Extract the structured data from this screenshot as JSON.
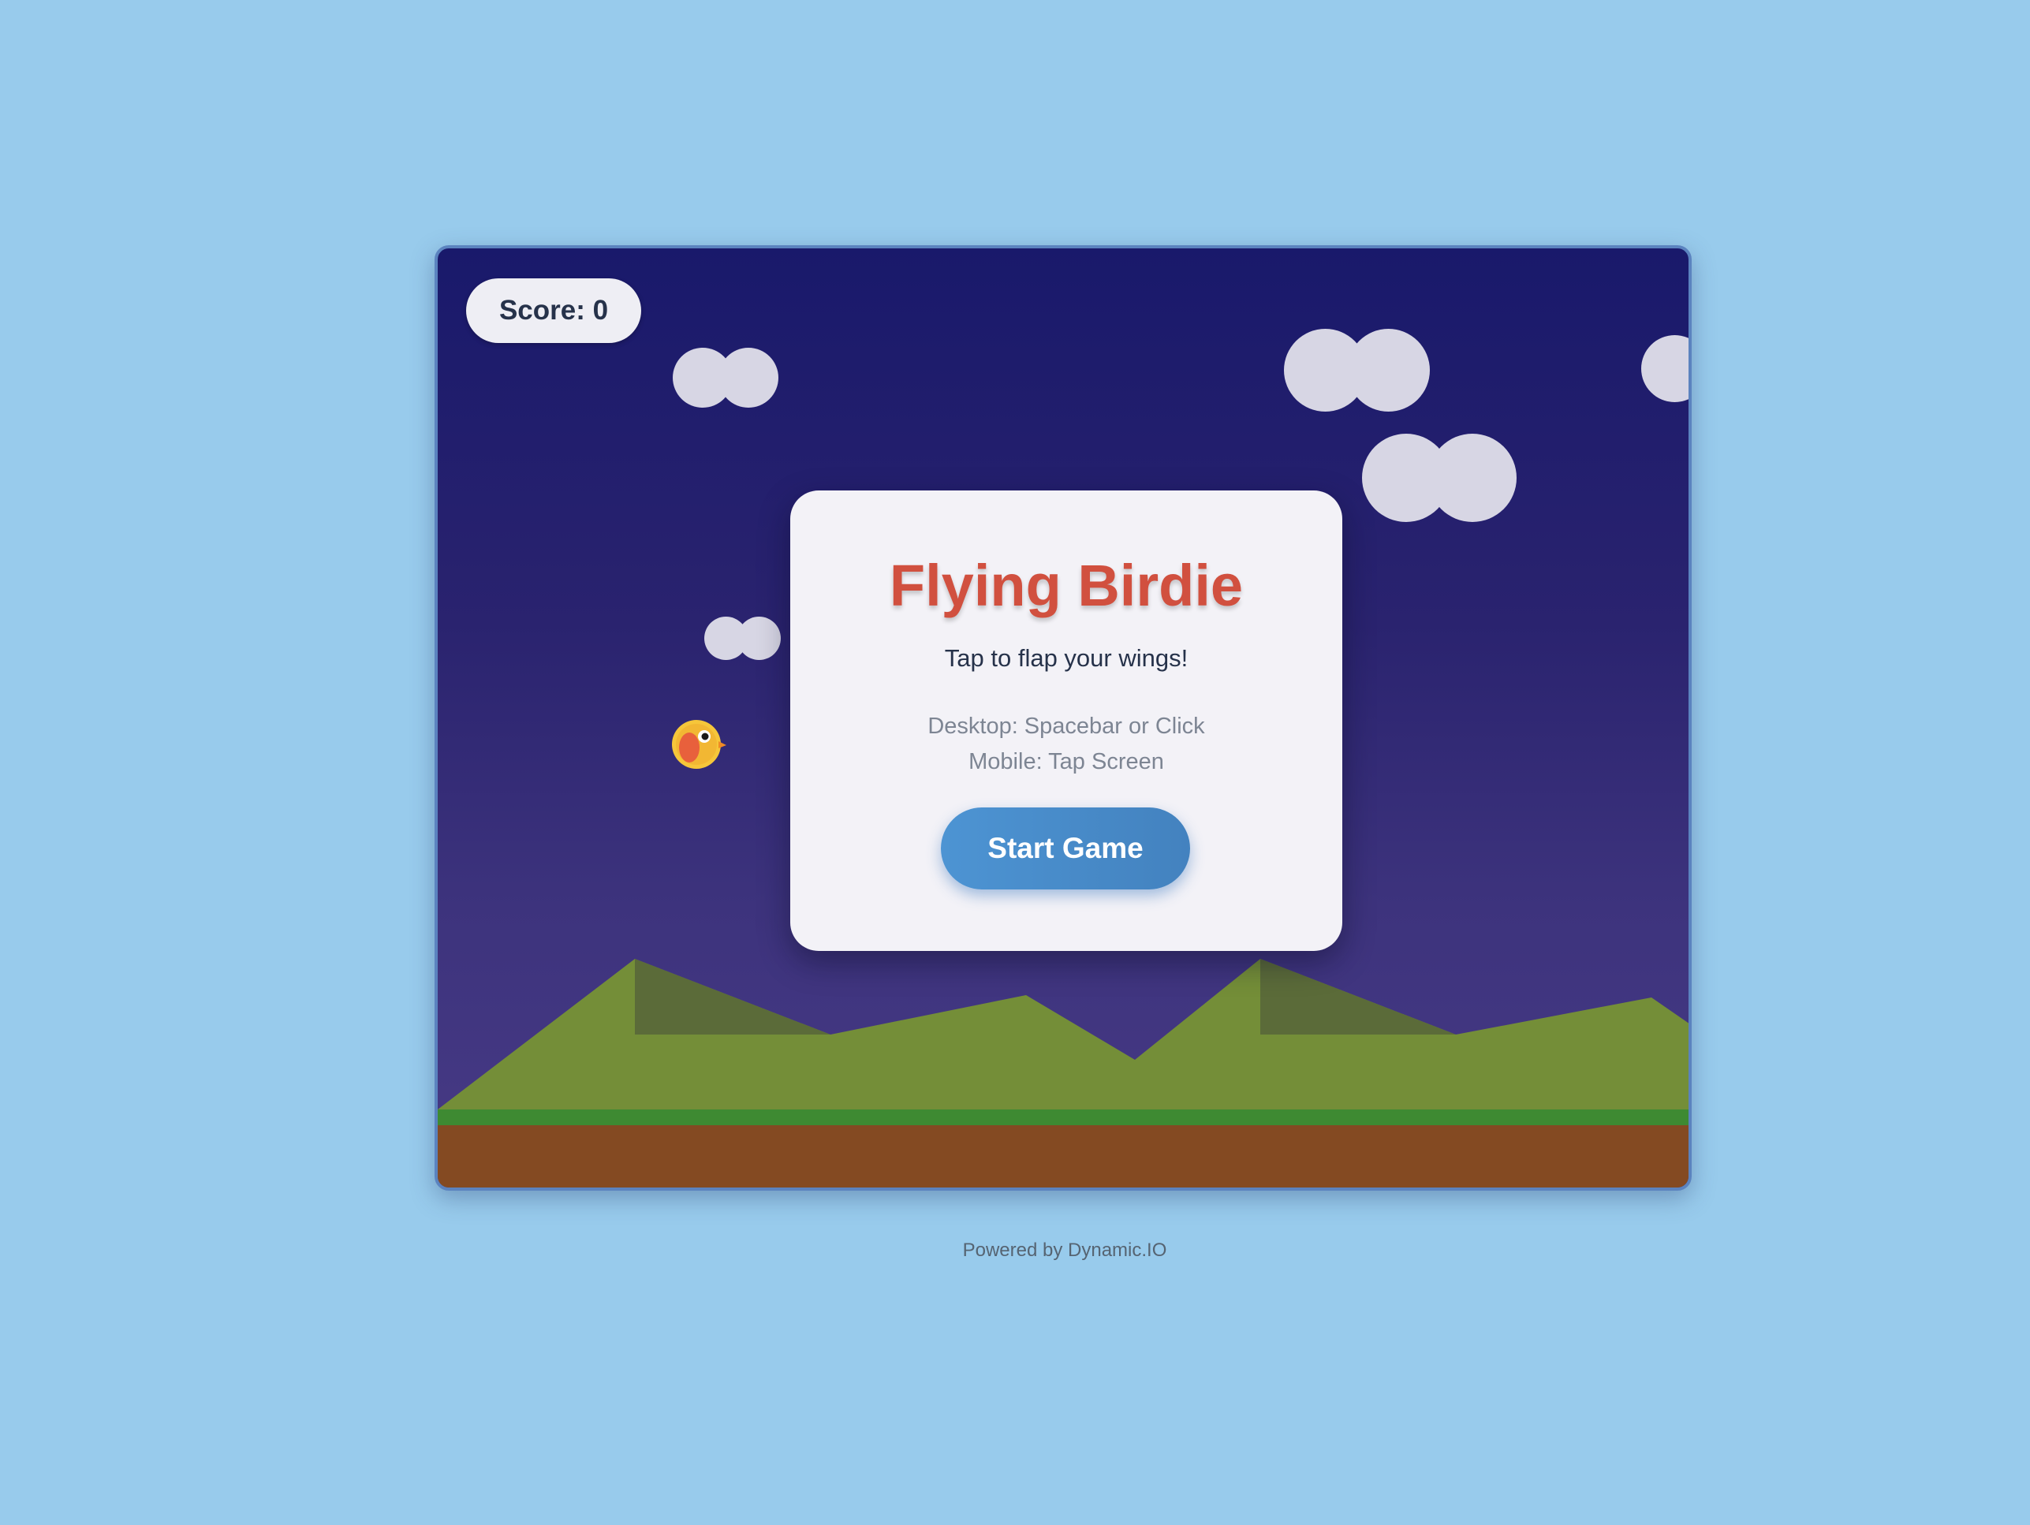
{
  "hud": {
    "score_label": "Score: 0"
  },
  "dialog": {
    "title": "Flying Birdie",
    "subtitle": "Tap to flap your wings!",
    "controls_desktop": "Desktop: Spacebar or Click",
    "controls_mobile": "Mobile: Tap Screen",
    "start_label": "Start Game"
  },
  "footer": {
    "text": "Powered by Dynamic.IO"
  },
  "colors": {
    "page_background": "#98cbec",
    "sky_top": "#19196b",
    "sky_bottom": "#473a85",
    "hills": "#748e38",
    "grass": "#3e8a32",
    "dirt": "#844a22",
    "title": "#d1503f",
    "button": "#4d94d3"
  },
  "icons": {
    "bird": "bird-icon",
    "cloud": "cloud-shape"
  }
}
